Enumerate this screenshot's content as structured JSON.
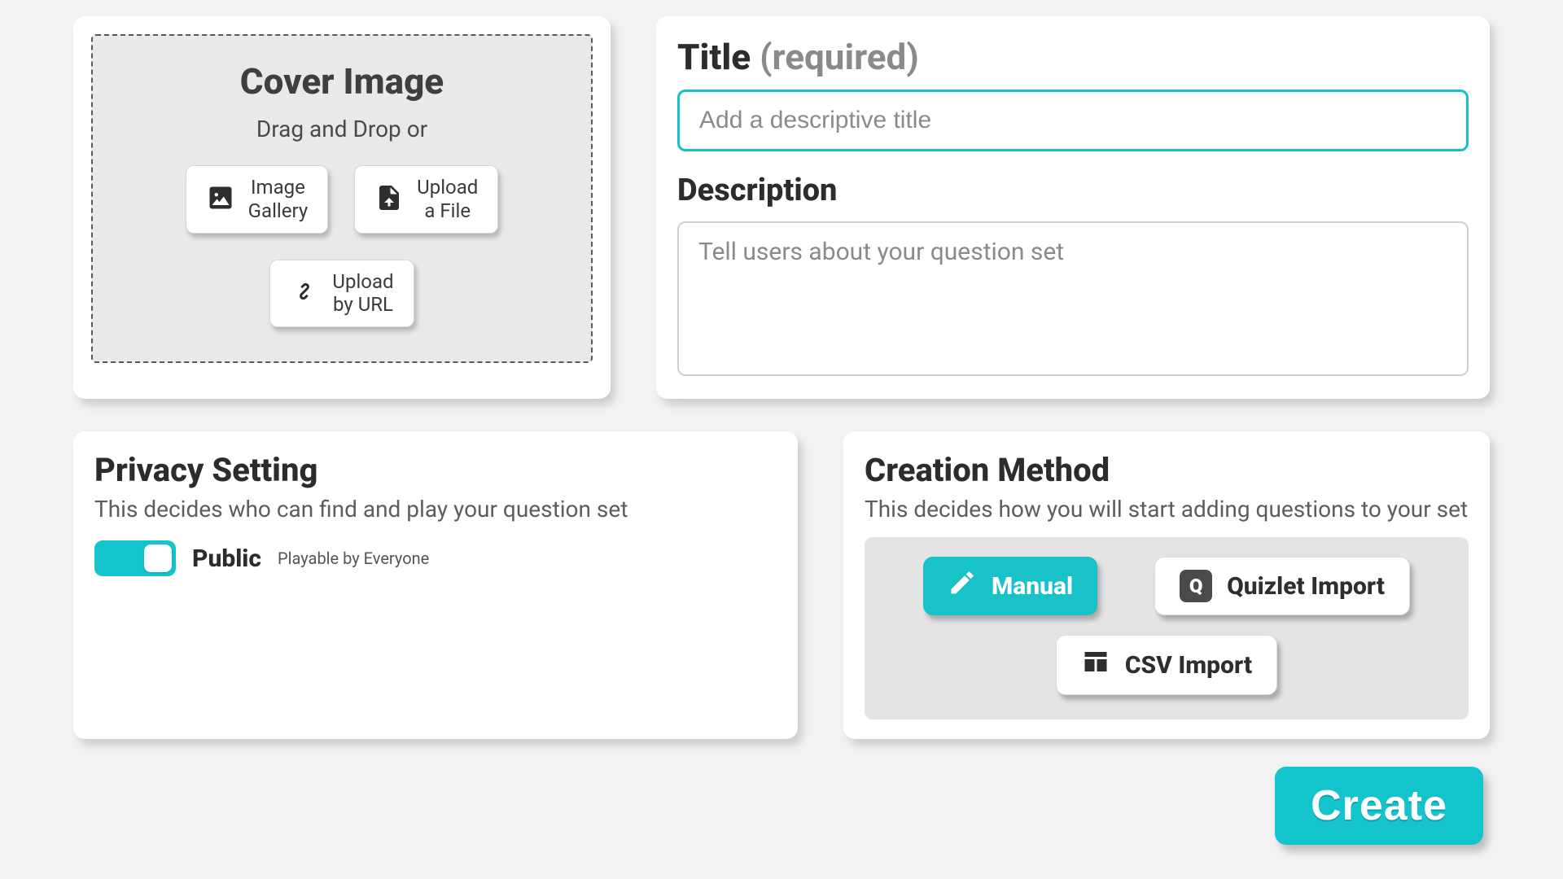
{
  "cover": {
    "title": "Cover Image",
    "subtitle": "Drag and Drop or",
    "buttons": {
      "gallery": "Image\nGallery",
      "file": "Upload\na File",
      "url": "Upload\nby URL"
    }
  },
  "form": {
    "title_label": "Title",
    "title_required": "(required)",
    "title_placeholder": "Add a descriptive title",
    "description_label": "Description",
    "description_placeholder": "Tell users about your question set"
  },
  "privacy": {
    "heading": "Privacy Setting",
    "sub": "This decides who can find and play your question set",
    "state_label": "Public",
    "state_sub": "Playable by Everyone",
    "is_public": true
  },
  "creation": {
    "heading": "Creation Method",
    "sub": "This decides how you will start adding questions to your set",
    "options": {
      "manual": "Manual",
      "quizlet": "Quizlet Import",
      "csv": "CSV Import"
    },
    "selected": "manual"
  },
  "actions": {
    "create": "Create"
  },
  "colors": {
    "accent": "#14c4cc"
  }
}
